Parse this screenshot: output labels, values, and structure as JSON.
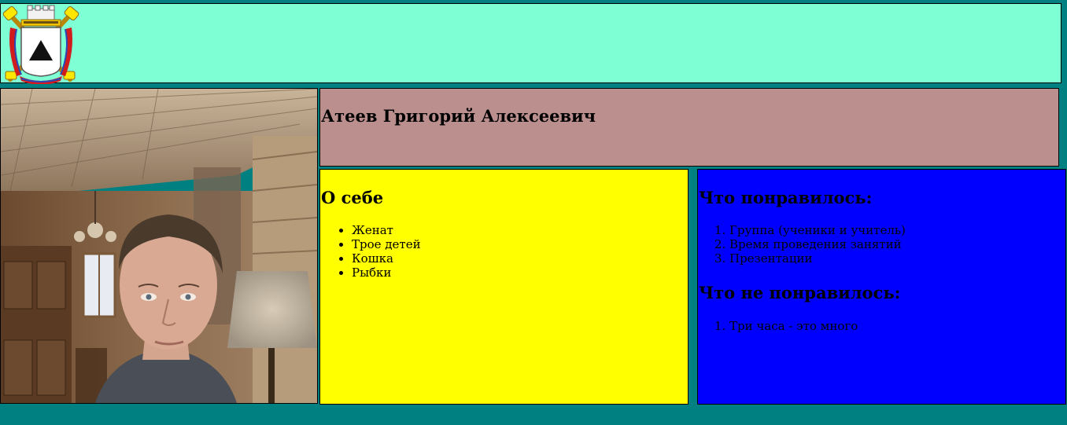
{
  "header": {
    "logo_icon": "city-coat-of-arms-icon",
    "background_color": "#7fffd4"
  },
  "photo": {
    "icon": "profile-photo-image"
  },
  "profile": {
    "name": "Атеев Григорий Алексеевич",
    "background_color": "#bc8f8f"
  },
  "about": {
    "title": "О себе",
    "background_color": "#ffff00",
    "items": [
      "Женат",
      "Трое детей",
      "Кошка",
      "Рыбки"
    ]
  },
  "feedback": {
    "background_color": "#0000ff",
    "liked_title": "Что понравилось:",
    "liked_items": [
      "Группа (ученики и учитель)",
      "Время проведения занятий",
      "Презентации"
    ],
    "disliked_title": "Что не понравилось:",
    "disliked_items": [
      "Три часа - это много"
    ]
  },
  "page": {
    "background_color": "#008080"
  }
}
